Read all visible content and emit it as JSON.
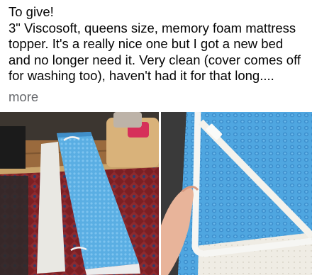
{
  "post": {
    "lines": [
      "To give!",
      "3\" Viscosoft, queens size, memory foam mattress",
      "topper. It's a really nice one but I got a new bed",
      "and no longer need it. Very clean (cover comes off",
      "for washing too), haven't had it for that long...."
    ],
    "see_more": "more"
  },
  "photos": [
    {
      "name": "rolled-mattress-topper-on-floor"
    },
    {
      "name": "topper-cover-corner-strap-closeup"
    }
  ],
  "colors": {
    "text": "#050505",
    "secondary_text": "#65676b",
    "mesh_blue": "#5fb0e6"
  }
}
